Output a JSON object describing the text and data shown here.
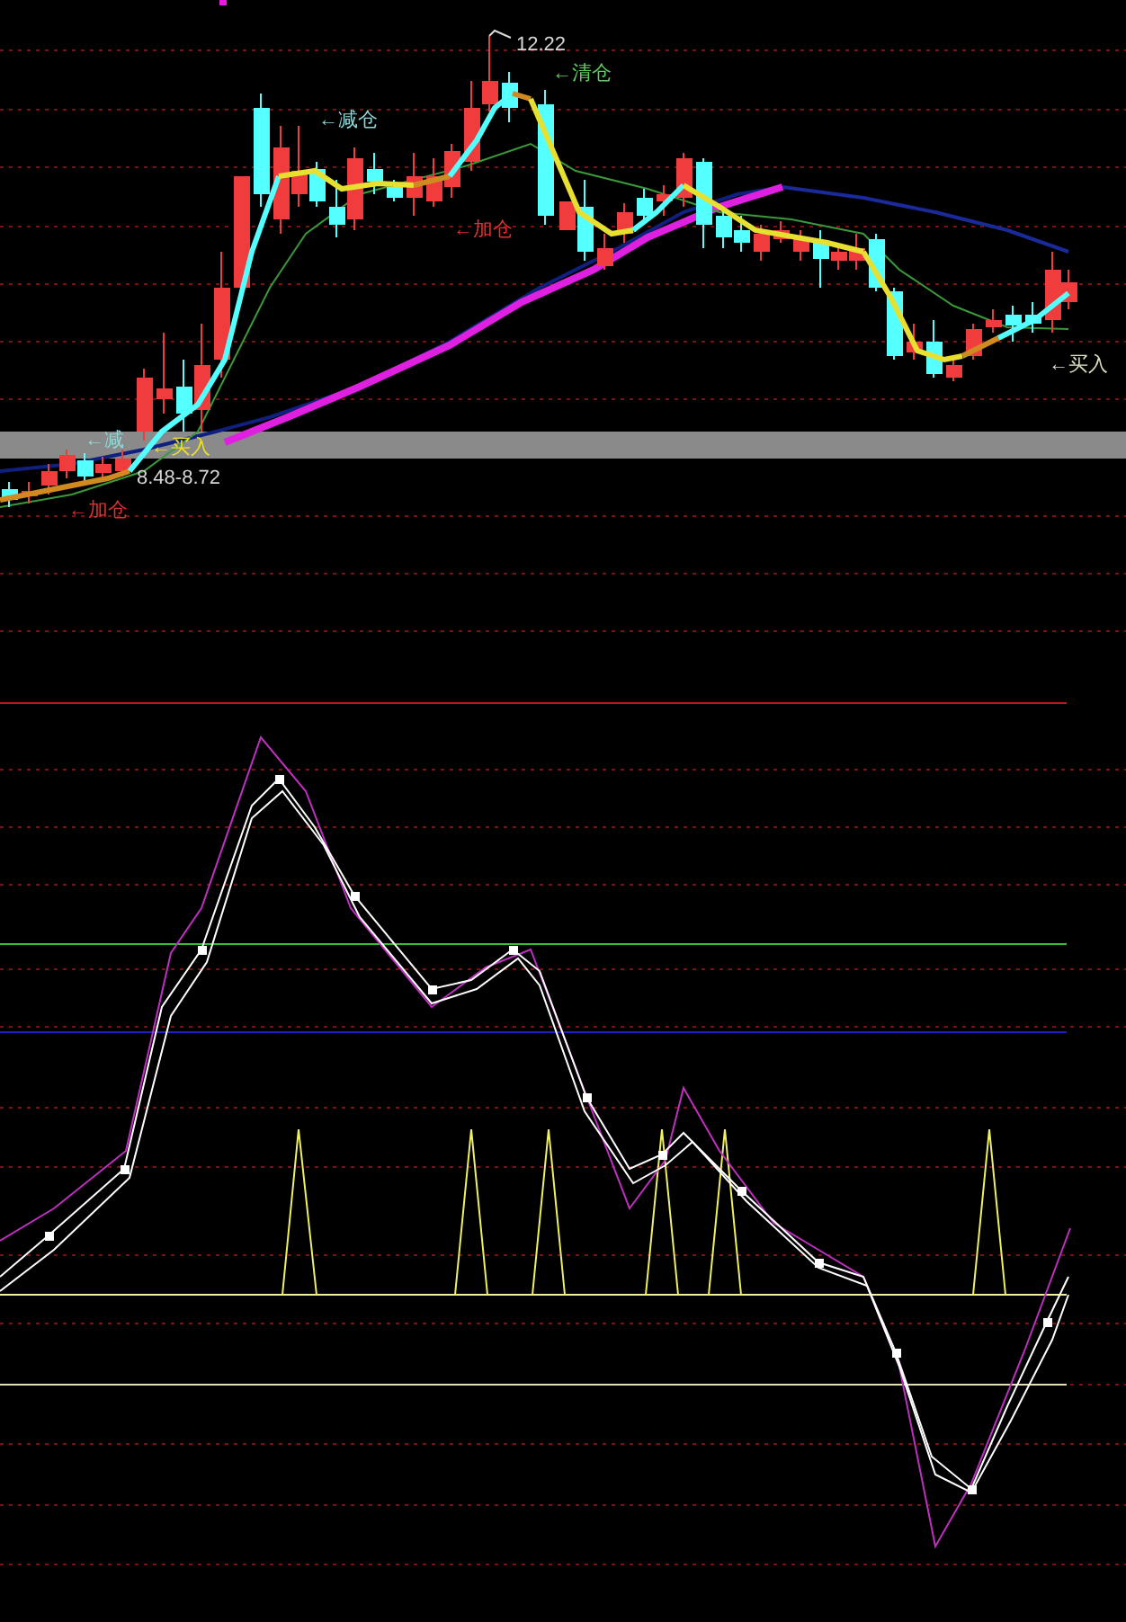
{
  "price_chart": {
    "annotations": [
      {
        "text": "12.22",
        "kind": "price"
      },
      {
        "text": "←清仓",
        "kind": "clear"
      },
      {
        "text": "←减仓",
        "kind": "reduce"
      },
      {
        "text": "←加仓",
        "kind": "add"
      },
      {
        "text": "←买入",
        "kind": "buy_right"
      },
      {
        "text": "←减",
        "kind": "reduce"
      },
      {
        "text": "←买入",
        "kind": "buy"
      },
      {
        "text": "8.48-8.72",
        "kind": "price"
      },
      {
        "text": "←加仓",
        "kind": "add"
      }
    ]
  }
}
